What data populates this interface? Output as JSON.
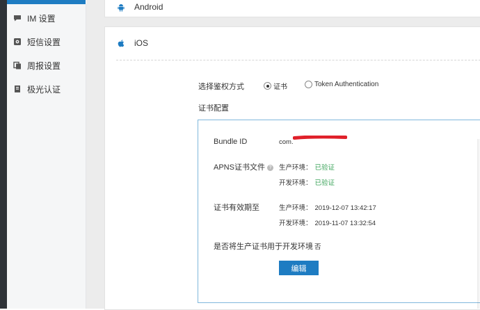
{
  "sidebar": {
    "items": [
      {
        "icon": "chat-bubble-icon",
        "label": "IM 设置"
      },
      {
        "icon": "gear-icon",
        "label": "短信设置"
      },
      {
        "icon": "report-icon",
        "label": "周报设置"
      },
      {
        "icon": "book-icon",
        "label": "极光认证"
      }
    ]
  },
  "platforms": {
    "android": {
      "icon": "android-icon",
      "label": "Android"
    },
    "ios": {
      "icon": "apple-icon",
      "label": "iOS"
    }
  },
  "auth": {
    "label": "选择鉴权方式",
    "options": [
      {
        "label": "证书",
        "selected": true
      },
      {
        "label": "Token Authentication",
        "selected": false
      }
    ]
  },
  "cert": {
    "title": "证书配置",
    "bundle_label": "Bundle ID",
    "bundle_value": "com.",
    "apns_label": "APNS证书文件",
    "apns_help": "?",
    "prod_env": "生产环境：",
    "dev_env": "开发环境：",
    "prod_status": "已验证",
    "dev_status": "已验证",
    "validity_label": "证书有效期至",
    "prod_expiry": "2019-12-07 13:42:17",
    "dev_expiry": "2019-11-07 13:32:54",
    "use_prod_label": "是否将生产证书用于开发环境",
    "use_prod_value": "否",
    "edit_button": "编辑"
  },
  "colors": {
    "accent": "#1e7cc2",
    "verified": "#3fa55d",
    "redaction": "#e0202a"
  }
}
